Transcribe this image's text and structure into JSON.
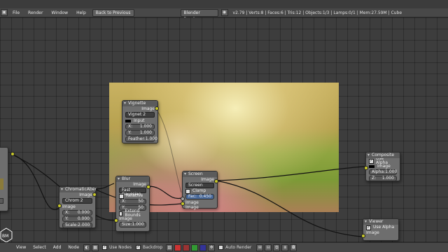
{
  "top_menu": {
    "file": "File",
    "render": "Render",
    "window": "Window",
    "help": "Help"
  },
  "back_button": "Back to Previous",
  "engine": "Blender Render",
  "stats": "v2.79 | Verts:8 | Faces:6 | Tris:12 | Objects:1/3 | Lamps:0/1 | Mem:27.59M | Cube",
  "nodes": {
    "vignette": {
      "title": "Vignette",
      "out": "Image",
      "name_field": "Vignet",
      "users": "2",
      "input_label": "Input",
      "x_label": "X:",
      "x_val": "1.000",
      "y_label": "Y:",
      "y_val": "1.000",
      "feather_label": "Feather:",
      "feather_val": "1.000"
    },
    "chromatic": {
      "title": "ChromaticAber",
      "out": "Image",
      "name_field": "Chrom",
      "users": "2",
      "in_label": "Image",
      "x_label": "X:",
      "x_val": "0.000",
      "y_label": "Y:",
      "y_val": "0.000",
      "scale_label": "Scale:",
      "scale_val": "2.000"
    },
    "blur": {
      "title": "Blur",
      "out": "Image",
      "type": "Fast Gaussian",
      "relative": "Relative",
      "x_label": "X:",
      "x_val": "50",
      "y_label": "Y:",
      "y_val": "50",
      "extend": "Extend Bounds",
      "in_label": "Image",
      "size_label": "Size:",
      "size_val": "1.000"
    },
    "screen": {
      "title": "Screen",
      "out": "Image",
      "mode": "Screen",
      "clamp": "Clamp",
      "fac_label": "Fac:",
      "fac_val": "0.450",
      "in1": "Image",
      "in2": "Image"
    },
    "composite": {
      "title": "Composite",
      "use_alpha": "Use Alpha",
      "image_label": "Image",
      "alpha_label": "Alpha:",
      "alpha_val": "1.000",
      "z_label": "Z:",
      "z_val": "1.000"
    },
    "viewer": {
      "title": "Viewer",
      "use_alpha": "Use Alpha",
      "image_label": "Image"
    }
  },
  "bottom_menu": {
    "view": "View",
    "select": "Select",
    "add": "Add",
    "node": "Node"
  },
  "use_nodes": "Use Nodes",
  "backdrop": "Backdrop",
  "auto_render": "Auto Render"
}
